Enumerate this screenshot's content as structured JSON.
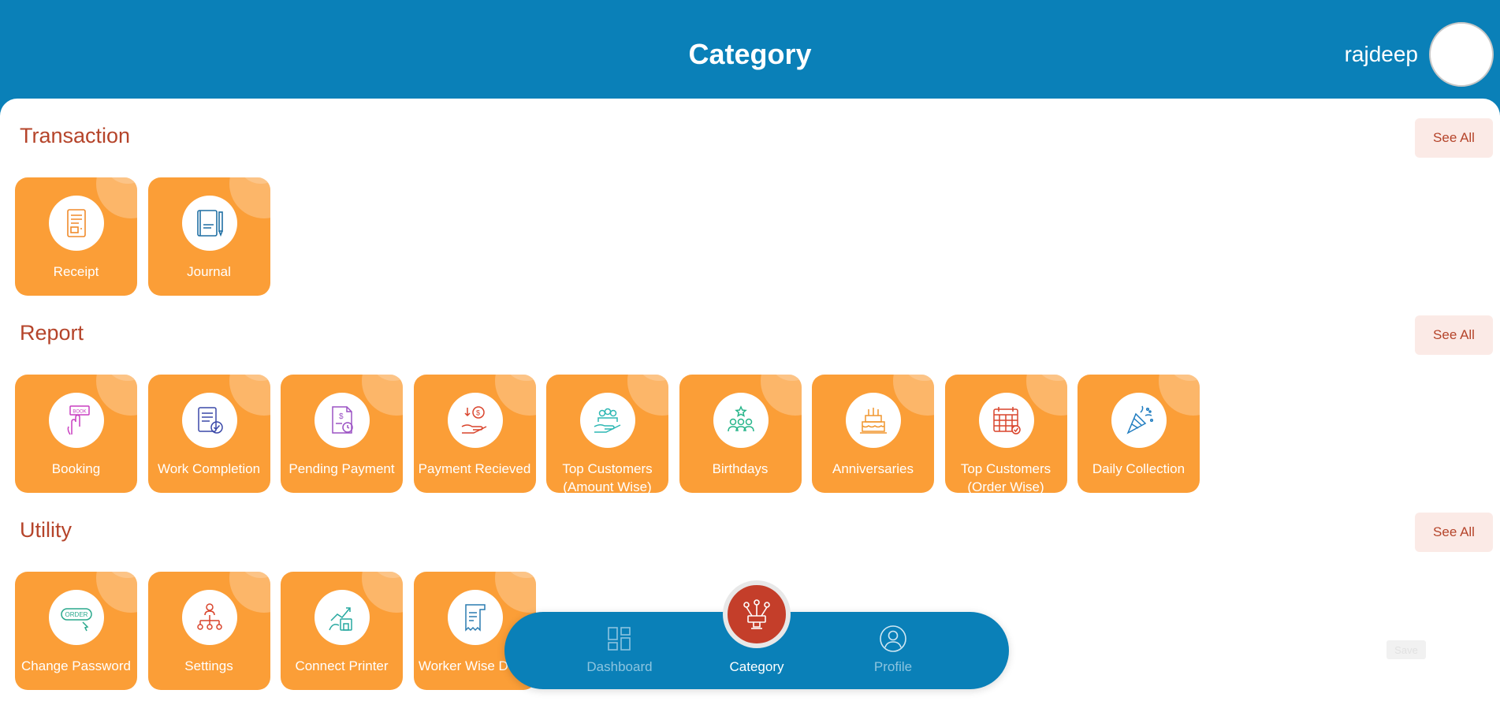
{
  "header": {
    "title": "Category",
    "user_name": "rajdeep"
  },
  "sections": {
    "transaction": {
      "title": "Transaction",
      "see_all": "See All",
      "tiles": [
        {
          "label": "Receipt",
          "icon": "receipt-icon"
        },
        {
          "label": "Journal",
          "icon": "journal-icon"
        }
      ]
    },
    "report": {
      "title": "Report",
      "see_all": "See All",
      "tiles": [
        {
          "label": "Booking",
          "icon": "booking-icon"
        },
        {
          "label": "Work Completion",
          "icon": "work-completion-icon"
        },
        {
          "label": "Pending Payment",
          "icon": "pending-payment-icon"
        },
        {
          "label": "Payment Recieved",
          "icon": "payment-received-icon"
        },
        {
          "label": "Top Customers (Amount Wise)",
          "icon": "top-customers-amount-icon"
        },
        {
          "label": "Birthdays",
          "icon": "birthdays-icon"
        },
        {
          "label": "Anniversaries",
          "icon": "anniversaries-icon"
        },
        {
          "label": "Top Customers (Order Wise)",
          "icon": "top-customers-order-icon"
        },
        {
          "label": "Daily Collection",
          "icon": "daily-collection-icon"
        }
      ]
    },
    "utility": {
      "title": "Utility",
      "see_all": "See All",
      "tiles": [
        {
          "label": "Change Password",
          "icon": "change-password-icon"
        },
        {
          "label": "Settings",
          "icon": "settings-icon"
        },
        {
          "label": "Connect Printer",
          "icon": "connect-printer-icon"
        },
        {
          "label": "Worker Wise Done",
          "icon": "worker-wise-icon"
        }
      ]
    }
  },
  "icon_text": {
    "book": "BOOK",
    "order": "ORDER"
  },
  "bottom_nav": {
    "dashboard": "Dashboard",
    "category": "Category",
    "profile": "Profile"
  },
  "save_label": "Save",
  "colors": {
    "brand_blue": "#0a80b8",
    "tile_orange": "#fb9e37",
    "section_title": "#b5442a",
    "see_all_bg": "#fbeae6",
    "fab_red": "#c43e2a"
  }
}
